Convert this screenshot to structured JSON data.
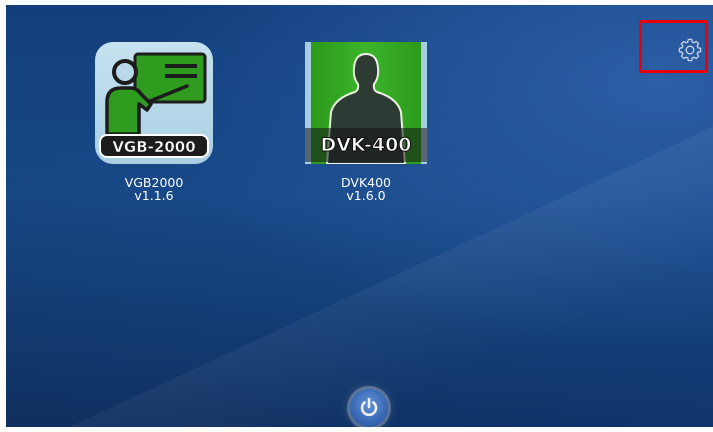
{
  "apps": [
    {
      "name": "VGB2000",
      "version": "v1.1.6",
      "badge": "VGB-2000",
      "icon": "teacher-presentation-icon",
      "colors": {
        "tile_bg": "#b8d9ea",
        "board": "#2f9b1f",
        "figure": "#1c1c1c"
      }
    },
    {
      "name": "DVK400",
      "version": "v1.6.0",
      "badge": "DVK-400",
      "icon": "person-silhouette-icon",
      "colors": {
        "tile_bg": "#3db42a",
        "figure": "#2e3a34"
      }
    }
  ],
  "toolbar": {
    "settings_icon": "gear-icon",
    "power_icon": "power-icon"
  },
  "annotation": {
    "highlight_color": "#e8000b"
  },
  "colors": {
    "background": "#184988",
    "power_button": "#3e72c4"
  }
}
